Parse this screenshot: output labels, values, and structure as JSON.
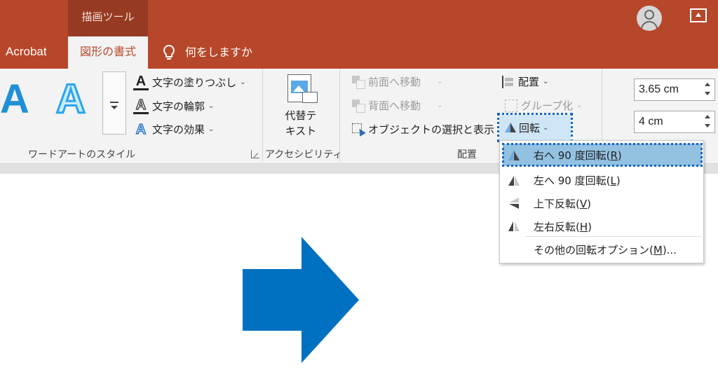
{
  "titlebar": {
    "context_group": "描画ツール",
    "tabs": {
      "acrobat": "Acrobat",
      "shape_format": "図形の書式"
    },
    "tell_me": "何をしますか"
  },
  "wordart": {
    "sample_letter": "A",
    "text_fill": "文字の塗りつぶし",
    "text_outline": "文字の輪郭",
    "text_effects": "文字の効果",
    "group_label": "ワードアートのスタイル"
  },
  "accessibility": {
    "alt_text_line1": "代替テ",
    "alt_text_line2": "キスト",
    "group_label": "アクセシビリティ"
  },
  "arrange": {
    "bring_forward": "前面へ移動",
    "send_backward": "背面へ移動",
    "selection_pane": "オブジェクトの選択と表示",
    "align": "配置",
    "group": "グループ化",
    "rotate": "回転",
    "group_label": "配置"
  },
  "size": {
    "height_value": "3.65 cm",
    "width_value": "4 cm"
  },
  "rotate_menu": {
    "items": [
      {
        "text": "右へ 90 度回転(",
        "key": "R",
        "tail": ")"
      },
      {
        "text": "左へ 90 度回転(",
        "key": "L",
        "tail": ")"
      },
      {
        "text": "上下反転(",
        "key": "V",
        "tail": ")"
      },
      {
        "text": "左右反転(",
        "key": "H",
        "tail": ")"
      },
      {
        "text": "その他の回転オプション(",
        "key": "M",
        "tail": ")..."
      }
    ]
  },
  "colors": {
    "ribbon_accent": "#b7472a",
    "context_group": "#973a22",
    "shape_fill": "#0070c0",
    "highlight": "#92c1e2",
    "focus_outline": "#1565c0"
  },
  "icons": {
    "tell_me": "lightbulb-icon",
    "account": "user-avatar-icon",
    "ribbon_display": "ribbon-display-options-icon"
  }
}
